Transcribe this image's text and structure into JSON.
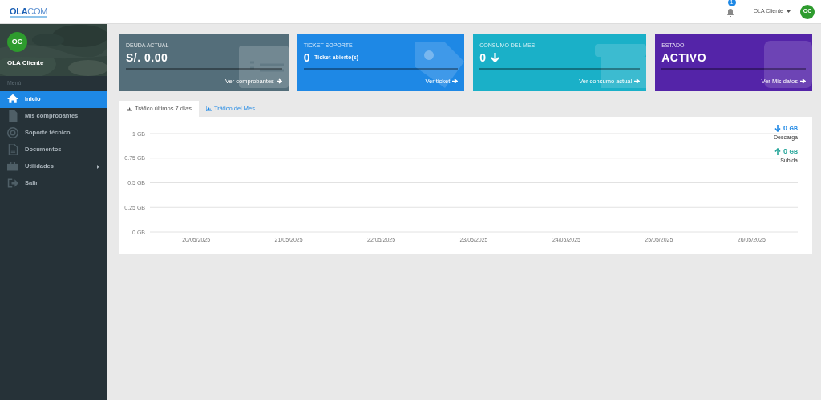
{
  "header": {
    "logo": {
      "part1": "OLA",
      "part2": "COM"
    },
    "notifications": "1",
    "user_name": "OLA Cliente",
    "avatar": "OC"
  },
  "sidebar": {
    "avatar": "OC",
    "user_name": "OLA Cliente",
    "section_label": "Menú",
    "items": [
      {
        "label": "Inicio",
        "selected": true,
        "expandable": false
      },
      {
        "label": "Mis comprobantes",
        "selected": false,
        "expandable": false
      },
      {
        "label": "Soporte técnico",
        "selected": false,
        "expandable": false
      },
      {
        "label": "Documentos",
        "selected": false,
        "expandable": false
      },
      {
        "label": "Utilidades",
        "selected": false,
        "expandable": true
      },
      {
        "label": "Salir",
        "selected": false,
        "expandable": false
      }
    ]
  },
  "cards": [
    {
      "kind": "debt",
      "label": "DEUDA ACTUAL",
      "value": "S/. 0.00",
      "link": "Ver comprobantes",
      "color": "#546e7a"
    },
    {
      "kind": "ticket",
      "label": "TICKET SOPORTE",
      "value": "0",
      "suffix": "Ticket abierto(s)",
      "link": "Ver ticket",
      "color": "#1e88e5"
    },
    {
      "kind": "usage",
      "label": "CONSUMO DEL MES",
      "value": "0",
      "link": "Ver consumo actual",
      "color": "#1ab0c8"
    },
    {
      "kind": "status",
      "label": "ESTADO",
      "value": "ACTIVO",
      "link": "Ver Mis datos",
      "color": "#5424a8"
    }
  ],
  "tabs": [
    {
      "label": "Tráfico últimos 7 días",
      "selected": true
    },
    {
      "label": "Tráfico del Mes",
      "selected": false
    }
  ],
  "legend": [
    {
      "value": "0",
      "unit": "GB",
      "label": "Descarga",
      "kind": "download",
      "color": "#1e88e5"
    },
    {
      "value": "0",
      "unit": "GB",
      "label": "Subida",
      "kind": "upload",
      "color": "#26a69a"
    }
  ],
  "chart_data": {
    "type": "line",
    "grid": true,
    "categories": [
      "20/05/2025",
      "21/05/2025",
      "22/05/2025",
      "23/05/2025",
      "24/05/2025",
      "25/05/2025",
      "26/05/2025"
    ],
    "ylim": [
      0,
      1
    ],
    "yticks": [
      {
        "value": 0,
        "label": "0 GB"
      },
      {
        "value": 0.25,
        "label": "0.25 GB"
      },
      {
        "value": 0.5,
        "label": "0.5 GB"
      },
      {
        "value": 0.75,
        "label": "0.75 GB"
      },
      {
        "value": 1,
        "label": "1 GB"
      }
    ]
  }
}
